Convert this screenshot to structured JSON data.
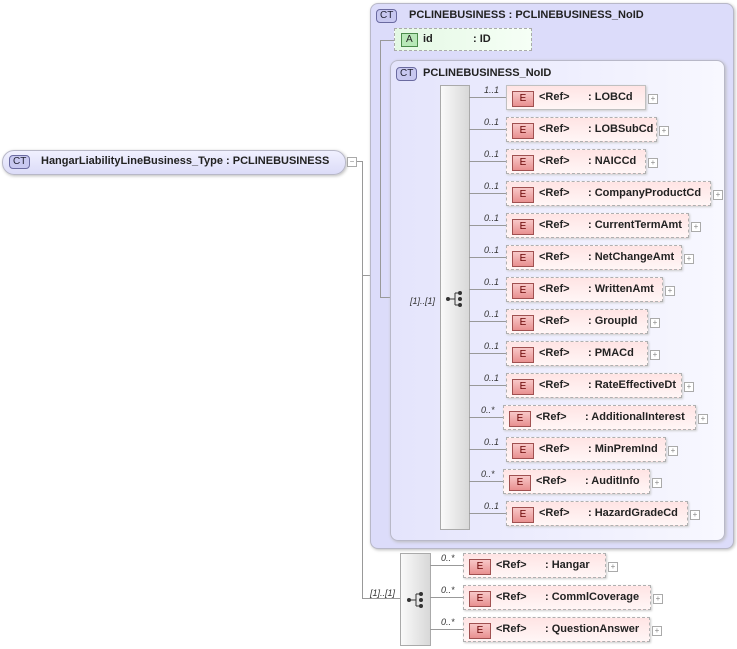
{
  "root": {
    "badge": "CT",
    "label": "HangarLiabilityLineBusiness_Type : PCLINEBUSINESS"
  },
  "outer": {
    "badge": "CT",
    "label": "PCLINEBUSINESS : PCLINEBUSINESS_NoID"
  },
  "attribute": {
    "badge": "A",
    "name": "id",
    "type": ": ID"
  },
  "inner": {
    "badge": "CT",
    "label": "PCLINEBUSINESS_NoID"
  },
  "seq1_card": "[1]..[1]",
  "seq2_card": "[1]..[1]",
  "elements": [
    {
      "card": "1..1",
      "ref": "<Ref>",
      "name": ": LOBCd",
      "optional": false
    },
    {
      "card": "0..1",
      "ref": "<Ref>",
      "name": ": LOBSubCd",
      "optional": true
    },
    {
      "card": "0..1",
      "ref": "<Ref>",
      "name": ": NAICCd",
      "optional": true
    },
    {
      "card": "0..1",
      "ref": "<Ref>",
      "name": ": CompanyProductCd",
      "optional": true
    },
    {
      "card": "0..1",
      "ref": "<Ref>",
      "name": ": CurrentTermAmt",
      "optional": true
    },
    {
      "card": "0..1",
      "ref": "<Ref>",
      "name": ": NetChangeAmt",
      "optional": true
    },
    {
      "card": "0..1",
      "ref": "<Ref>",
      "name": ": WrittenAmt",
      "optional": true
    },
    {
      "card": "0..1",
      "ref": "<Ref>",
      "name": ": GroupId",
      "optional": true
    },
    {
      "card": "0..1",
      "ref": "<Ref>",
      "name": ": PMACd",
      "optional": true
    },
    {
      "card": "0..1",
      "ref": "<Ref>",
      "name": ": RateEffectiveDt",
      "optional": true
    },
    {
      "card": "0..*",
      "ref": "<Ref>",
      "name": ": AdditionalInterest",
      "optional": true
    },
    {
      "card": "0..1",
      "ref": "<Ref>",
      "name": ": MinPremInd",
      "optional": true
    },
    {
      "card": "0..*",
      "ref": "<Ref>",
      "name": ": AuditInfo",
      "optional": true
    },
    {
      "card": "0..1",
      "ref": "<Ref>",
      "name": ": HazardGradeCd",
      "optional": true
    }
  ],
  "elements2": [
    {
      "card": "0..*",
      "ref": "<Ref>",
      "name": ": Hangar",
      "optional": true
    },
    {
      "card": "0..*",
      "ref": "<Ref>",
      "name": ": CommlCoverage",
      "optional": true
    },
    {
      "card": "0..*",
      "ref": "<Ref>",
      "name": ": QuestionAnswer",
      "optional": true
    }
  ],
  "element_icon": "E"
}
